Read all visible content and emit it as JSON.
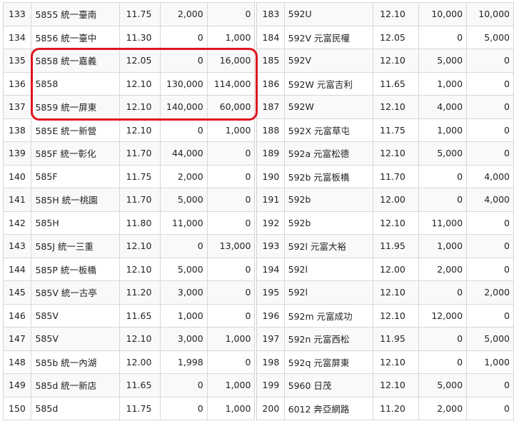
{
  "rows_left": [
    {
      "no": "133",
      "name": "5855 統一臺南",
      "price": "11.75",
      "q1": "2,000",
      "q2": "0"
    },
    {
      "no": "134",
      "name": "5856 統一臺中",
      "price": "11.30",
      "q1": "0",
      "q2": "1,000"
    },
    {
      "no": "135",
      "name": "5858 統一嘉義",
      "price": "12.05",
      "q1": "0",
      "q2": "16,000"
    },
    {
      "no": "136",
      "name": "5858",
      "price": "12.10",
      "q1": "130,000",
      "q2": "114,000"
    },
    {
      "no": "137",
      "name": "5859 統一屏東",
      "price": "12.10",
      "q1": "140,000",
      "q2": "60,000"
    },
    {
      "no": "138",
      "name": "585E 統一新營",
      "price": "12.10",
      "q1": "0",
      "q2": "1,000"
    },
    {
      "no": "139",
      "name": "585F 統一彰化",
      "price": "11.70",
      "q1": "44,000",
      "q2": "0"
    },
    {
      "no": "140",
      "name": "585F",
      "price": "11.75",
      "q1": "2,000",
      "q2": "0"
    },
    {
      "no": "141",
      "name": "585H 統一桃園",
      "price": "11.70",
      "q1": "5,000",
      "q2": "0"
    },
    {
      "no": "142",
      "name": "585H",
      "price": "11.80",
      "q1": "11,000",
      "q2": "0"
    },
    {
      "no": "143",
      "name": "585J 統一三重",
      "price": "12.10",
      "q1": "0",
      "q2": "13,000"
    },
    {
      "no": "144",
      "name": "585P 統一板橋",
      "price": "12.10",
      "q1": "5,000",
      "q2": "0"
    },
    {
      "no": "145",
      "name": "585V 統一古亭",
      "price": "11.20",
      "q1": "3,000",
      "q2": "0"
    },
    {
      "no": "146",
      "name": "585V",
      "price": "11.65",
      "q1": "1,000",
      "q2": "0"
    },
    {
      "no": "147",
      "name": "585V",
      "price": "12.10",
      "q1": "3,000",
      "q2": "1,000"
    },
    {
      "no": "148",
      "name": "585b 統一內湖",
      "price": "12.00",
      "q1": "1,998",
      "q2": "0"
    },
    {
      "no": "149",
      "name": "585d 統一新店",
      "price": "11.65",
      "q1": "0",
      "q2": "1,000"
    },
    {
      "no": "150",
      "name": "585d",
      "price": "11.75",
      "q1": "0",
      "q2": "1,000"
    }
  ],
  "rows_right": [
    {
      "no": "183",
      "name": "592U",
      "price": "12.10",
      "q1": "10,000",
      "q2": "10,000"
    },
    {
      "no": "184",
      "name": "592V 元富民權",
      "price": "12.05",
      "q1": "0",
      "q2": "5,000"
    },
    {
      "no": "185",
      "name": "592V",
      "price": "12.10",
      "q1": "5,000",
      "q2": "0"
    },
    {
      "no": "186",
      "name": "592W 元富吉利",
      "price": "11.65",
      "q1": "1,000",
      "q2": "0"
    },
    {
      "no": "187",
      "name": "592W",
      "price": "12.10",
      "q1": "4,000",
      "q2": "0"
    },
    {
      "no": "188",
      "name": "592X 元富草屯",
      "price": "11.75",
      "q1": "1,000",
      "q2": "0"
    },
    {
      "no": "189",
      "name": "592a 元富松德",
      "price": "12.10",
      "q1": "5,000",
      "q2": "0"
    },
    {
      "no": "190",
      "name": "592b 元富板橋",
      "price": "11.70",
      "q1": "0",
      "q2": "4,000"
    },
    {
      "no": "191",
      "name": "592b",
      "price": "12.00",
      "q1": "0",
      "q2": "4,000"
    },
    {
      "no": "192",
      "name": "592b",
      "price": "12.10",
      "q1": "11,000",
      "q2": "0"
    },
    {
      "no": "193",
      "name": "592l 元富大裕",
      "price": "11.95",
      "q1": "1,000",
      "q2": "0"
    },
    {
      "no": "194",
      "name": "592l",
      "price": "12.00",
      "q1": "2,000",
      "q2": "0"
    },
    {
      "no": "195",
      "name": "592l",
      "price": "12.10",
      "q1": "0",
      "q2": "2,000"
    },
    {
      "no": "196",
      "name": "592m 元富成功",
      "price": "12.10",
      "q1": "12,000",
      "q2": "0"
    },
    {
      "no": "197",
      "name": "592n 元富西松",
      "price": "11.95",
      "q1": "0",
      "q2": "5,000"
    },
    {
      "no": "198",
      "name": "592q 元富屏東",
      "price": "12.10",
      "q1": "0",
      "q2": "1,000"
    },
    {
      "no": "199",
      "name": "5960 日茂",
      "price": "12.10",
      "q1": "5,000",
      "q2": "0"
    },
    {
      "no": "200",
      "name": "6012 奔亞網路",
      "price": "11.20",
      "q1": "2,000",
      "q2": "0"
    }
  ],
  "colors": {
    "highlight": "#e0141e",
    "row_alt": "#f9f9f9",
    "border": "#d8d8d8"
  }
}
